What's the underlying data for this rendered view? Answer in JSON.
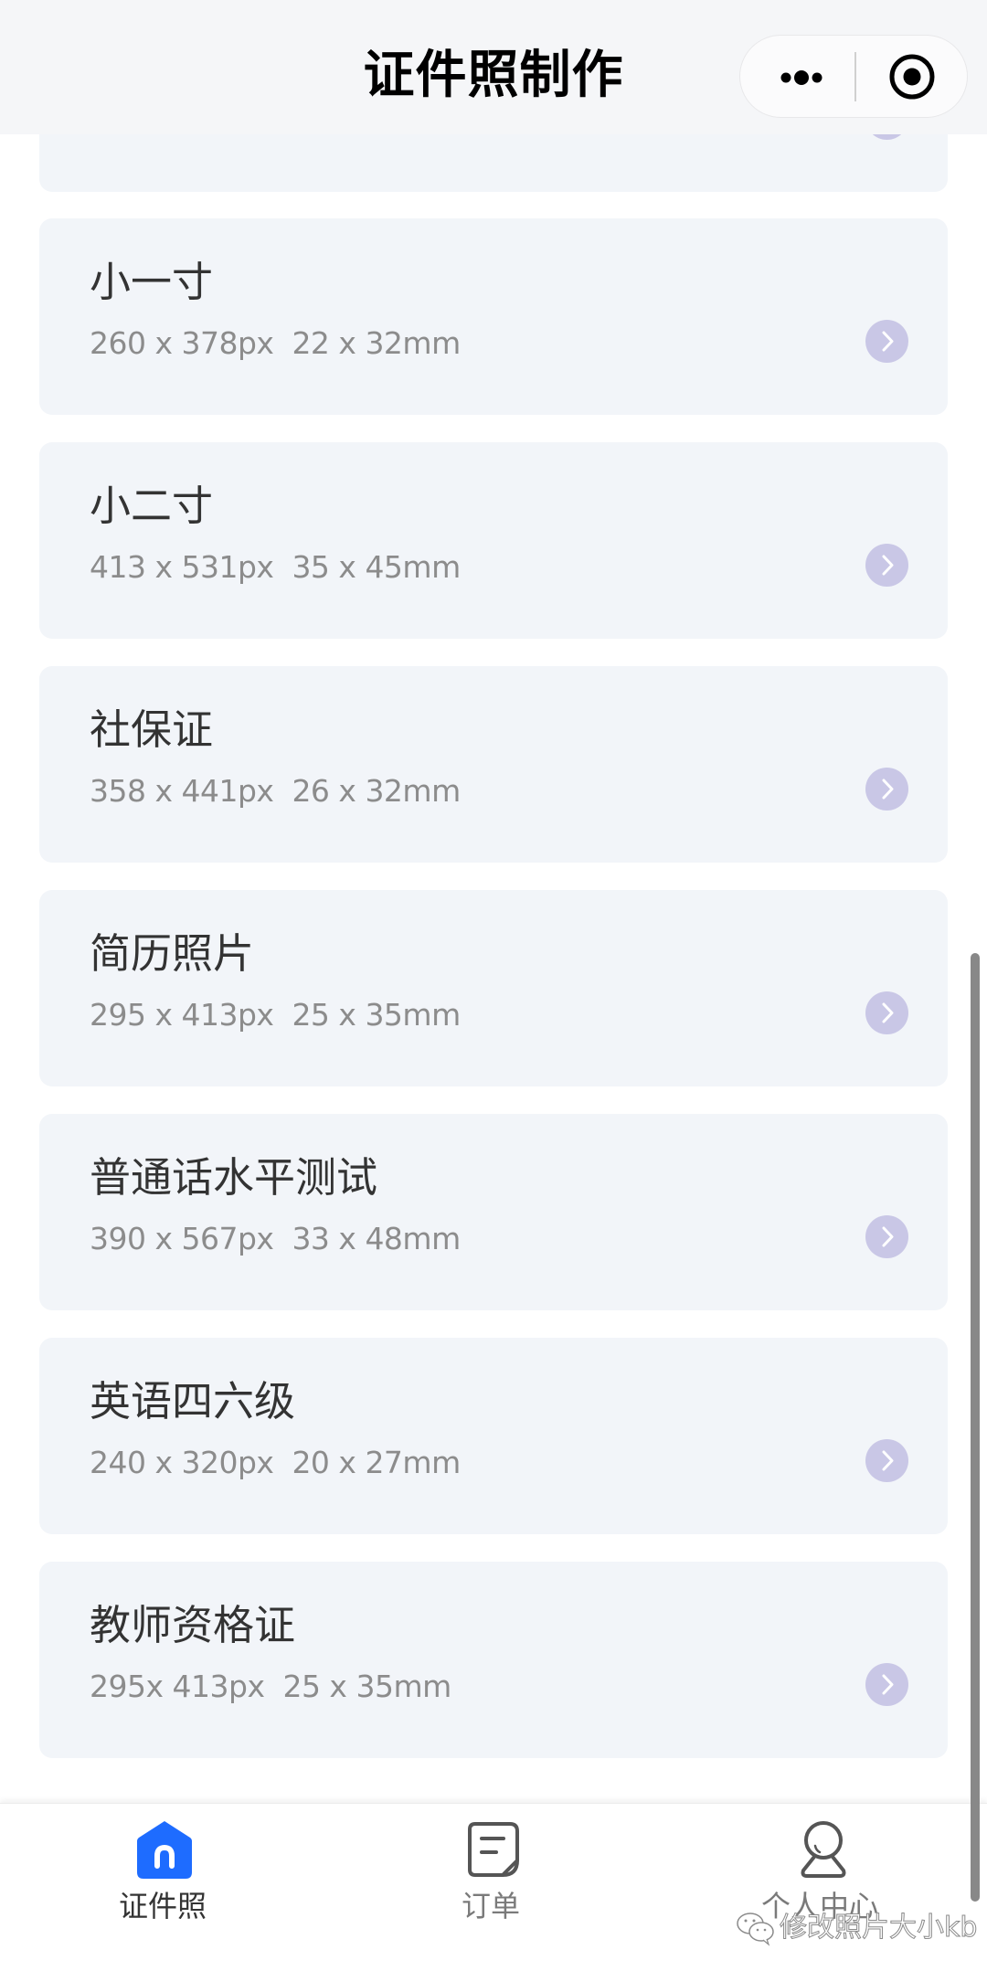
{
  "header": {
    "title": "证件照制作",
    "more_icon": "more-dots-icon",
    "close_icon": "target-circle-icon"
  },
  "cards": [
    {
      "title": "",
      "spec": ""
    },
    {
      "title": "小一寸",
      "spec": "260 x 378px  22 x 32mm"
    },
    {
      "title": "小二寸",
      "spec": "413 x 531px  35 x 45mm"
    },
    {
      "title": "社保证",
      "spec": "358 x 441px  26 x 32mm"
    },
    {
      "title": "简历照片",
      "spec": "295 x 413px  25 x 35mm"
    },
    {
      "title": "普通话水平测试",
      "spec": "390 x 567px  33 x 48mm"
    },
    {
      "title": "英语四六级",
      "spec": "240 x 320px  20 x 27mm"
    },
    {
      "title": "教师资格证",
      "spec": "295x 413px  25 x 35mm"
    }
  ],
  "tabbar": {
    "tabs": [
      {
        "label": "证件照",
        "icon": "home-icon",
        "active": true
      },
      {
        "label": "订单",
        "icon": "order-document-icon",
        "active": false
      },
      {
        "label": "个人中心",
        "icon": "profile-person-icon",
        "active": false
      }
    ]
  },
  "colors": {
    "accent": "#1e6cff",
    "card_bg": "#f2f5f9",
    "arrow_circle": "#c9c7e6",
    "title_text": "#333333",
    "spec_text": "#8c8c8c"
  },
  "watermark": {
    "text": "修改照片大小kb",
    "icon": "wechat-icon"
  }
}
